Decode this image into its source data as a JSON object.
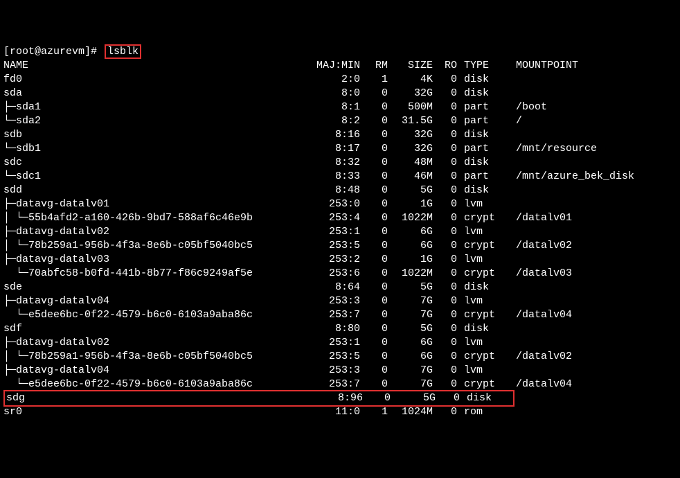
{
  "prompt": "[root@azurevm]#",
  "command": "lsblk",
  "headers": {
    "name": "NAME",
    "majmin": "MAJ:MIN",
    "rm": "RM",
    "size": "SIZE",
    "ro": "RO",
    "type": "TYPE",
    "mnt": "MOUNTPOINT"
  },
  "rows": [
    {
      "name": "fd0",
      "mm": "2:0",
      "rm": "1",
      "size": "4K",
      "ro": "0",
      "type": "disk",
      "mnt": ""
    },
    {
      "name": "sda",
      "mm": "8:0",
      "rm": "0",
      "size": "32G",
      "ro": "0",
      "type": "disk",
      "mnt": ""
    },
    {
      "name": "├─sda1",
      "mm": "8:1",
      "rm": "0",
      "size": "500M",
      "ro": "0",
      "type": "part",
      "mnt": "/boot"
    },
    {
      "name": "└─sda2",
      "mm": "8:2",
      "rm": "0",
      "size": "31.5G",
      "ro": "0",
      "type": "part",
      "mnt": "/"
    },
    {
      "name": "sdb",
      "mm": "8:16",
      "rm": "0",
      "size": "32G",
      "ro": "0",
      "type": "disk",
      "mnt": ""
    },
    {
      "name": "└─sdb1",
      "mm": "8:17",
      "rm": "0",
      "size": "32G",
      "ro": "0",
      "type": "part",
      "mnt": "/mnt/resource"
    },
    {
      "name": "sdc",
      "mm": "8:32",
      "rm": "0",
      "size": "48M",
      "ro": "0",
      "type": "disk",
      "mnt": ""
    },
    {
      "name": "└─sdc1",
      "mm": "8:33",
      "rm": "0",
      "size": "46M",
      "ro": "0",
      "type": "part",
      "mnt": "/mnt/azure_bek_disk"
    },
    {
      "name": "sdd",
      "mm": "8:48",
      "rm": "0",
      "size": "5G",
      "ro": "0",
      "type": "disk",
      "mnt": ""
    },
    {
      "name": "├─datavg-datalv01",
      "mm": "253:0",
      "rm": "0",
      "size": "1G",
      "ro": "0",
      "type": "lvm",
      "mnt": ""
    },
    {
      "name": "│ └─55b4afd2-a160-426b-9bd7-588af6c46e9b",
      "mm": "253:4",
      "rm": "0",
      "size": "1022M",
      "ro": "0",
      "type": "crypt",
      "mnt": "/datalv01"
    },
    {
      "name": "├─datavg-datalv02",
      "mm": "253:1",
      "rm": "0",
      "size": "6G",
      "ro": "0",
      "type": "lvm",
      "mnt": ""
    },
    {
      "name": "│ └─78b259a1-956b-4f3a-8e6b-c05bf5040bc5",
      "mm": "253:5",
      "rm": "0",
      "size": "6G",
      "ro": "0",
      "type": "crypt",
      "mnt": "/datalv02"
    },
    {
      "name": "├─datavg-datalv03",
      "mm": "253:2",
      "rm": "0",
      "size": "1G",
      "ro": "0",
      "type": "lvm",
      "mnt": ""
    },
    {
      "name": "  └─70abfc58-b0fd-441b-8b77-f86c9249af5e",
      "mm": "253:6",
      "rm": "0",
      "size": "1022M",
      "ro": "0",
      "type": "crypt",
      "mnt": "/datalv03"
    },
    {
      "name": "sde",
      "mm": "8:64",
      "rm": "0",
      "size": "5G",
      "ro": "0",
      "type": "disk",
      "mnt": ""
    },
    {
      "name": "├─datavg-datalv04",
      "mm": "253:3",
      "rm": "0",
      "size": "7G",
      "ro": "0",
      "type": "lvm",
      "mnt": ""
    },
    {
      "name": "  └─e5dee6bc-0f22-4579-b6c0-6103a9aba86c",
      "mm": "253:7",
      "rm": "0",
      "size": "7G",
      "ro": "0",
      "type": "crypt",
      "mnt": "/datalv04"
    },
    {
      "name": "sdf",
      "mm": "8:80",
      "rm": "0",
      "size": "5G",
      "ro": "0",
      "type": "disk",
      "mnt": ""
    },
    {
      "name": "├─datavg-datalv02",
      "mm": "253:1",
      "rm": "0",
      "size": "6G",
      "ro": "0",
      "type": "lvm",
      "mnt": ""
    },
    {
      "name": "│ └─78b259a1-956b-4f3a-8e6b-c05bf5040bc5",
      "mm": "253:5",
      "rm": "0",
      "size": "6G",
      "ro": "0",
      "type": "crypt",
      "mnt": "/datalv02"
    },
    {
      "name": "├─datavg-datalv04",
      "mm": "253:3",
      "rm": "0",
      "size": "7G",
      "ro": "0",
      "type": "lvm",
      "mnt": ""
    },
    {
      "name": "  └─e5dee6bc-0f22-4579-b6c0-6103a9aba86c",
      "mm": "253:7",
      "rm": "0",
      "size": "7G",
      "ro": "0",
      "type": "crypt",
      "mnt": "/datalv04"
    },
    {
      "name": "sdg",
      "mm": "8:96",
      "rm": "0",
      "size": "5G",
      "ro": "0",
      "type": "disk",
      "mnt": "",
      "highlight": true
    },
    {
      "name": "sr0",
      "mm": "11:0",
      "rm": "1",
      "size": "1024M",
      "ro": "0",
      "type": "rom",
      "mnt": ""
    }
  ]
}
